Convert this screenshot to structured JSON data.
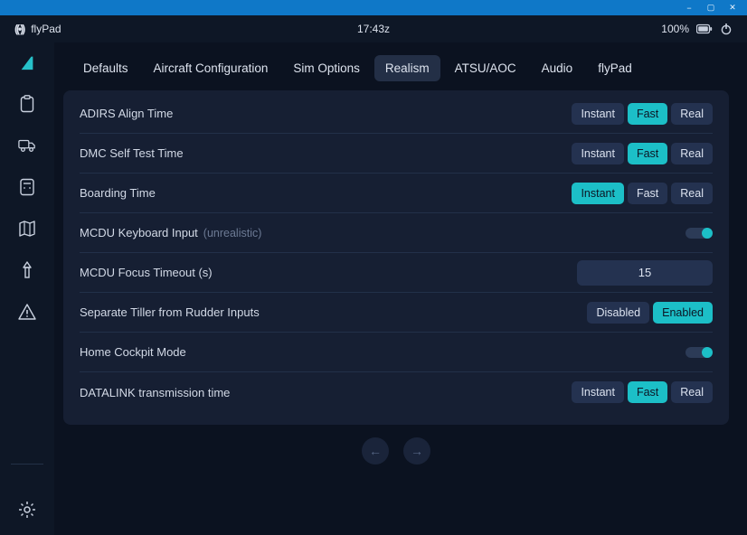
{
  "window": {
    "minimize": "−",
    "maximize": "▢",
    "close": "✕"
  },
  "header": {
    "app_name": "flyPad",
    "clock": "17:43z",
    "battery": "100%"
  },
  "tabs": [
    {
      "label": "Defaults",
      "active": false
    },
    {
      "label": "Aircraft Configuration",
      "active": false
    },
    {
      "label": "Sim Options",
      "active": false
    },
    {
      "label": "Realism",
      "active": true
    },
    {
      "label": "ATSU/AOC",
      "active": false
    },
    {
      "label": "Audio",
      "active": false
    },
    {
      "label": "flyPad",
      "active": false
    }
  ],
  "seg_options": {
    "instant": "Instant",
    "fast": "Fast",
    "real": "Real"
  },
  "tiller_options": {
    "disabled": "Disabled",
    "enabled": "Enabled"
  },
  "settings": {
    "adirs": {
      "label": "ADIRS Align Time",
      "selected": "fast"
    },
    "dmc": {
      "label": "DMC Self Test Time",
      "selected": "fast"
    },
    "boarding": {
      "label": "Boarding Time",
      "selected": "instant"
    },
    "mcdu_kb": {
      "label": "MCDU Keyboard Input",
      "hint": "(unrealistic)",
      "on": true
    },
    "mcdu_timeout": {
      "label": "MCDU Focus Timeout (s)",
      "value": "15"
    },
    "tiller": {
      "label": "Separate Tiller from Rudder Inputs",
      "selected": "enabled"
    },
    "home_cockpit": {
      "label": "Home Cockpit Mode",
      "on": true
    },
    "datalink": {
      "label": "DATALINK transmission time",
      "selected": "fast"
    }
  },
  "pager": {
    "prev": "←",
    "next": "→"
  }
}
